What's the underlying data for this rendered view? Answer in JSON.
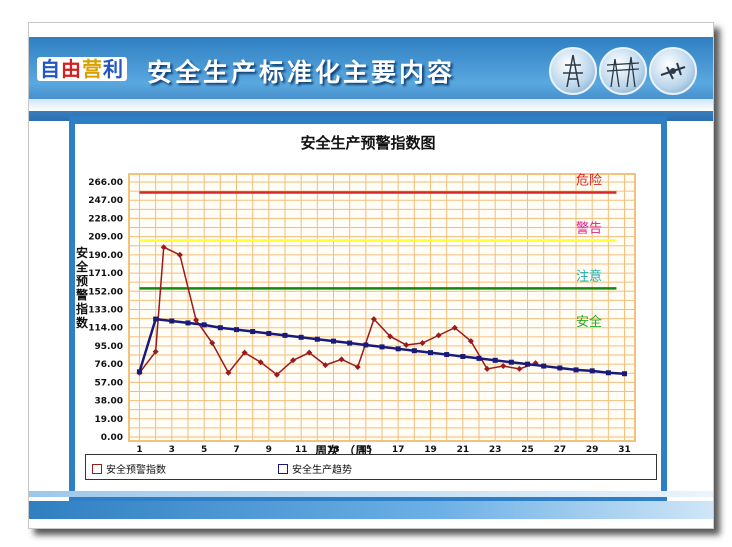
{
  "header": {
    "logo": [
      "自",
      "由",
      "营",
      "利"
    ],
    "title": "安全生产标准化主要内容"
  },
  "chart_data": {
    "type": "line",
    "title": "安全生产预警指数图",
    "xlabel": "周次 （周）",
    "ylabel": "安全预警指数",
    "ylim": [
      0,
      266
    ],
    "yticks": [
      "0.00",
      "19.00",
      "38.00",
      "57.00",
      "76.00",
      "95.00",
      "114.00",
      "133.00",
      "152.00",
      "171.00",
      "190.00",
      "209.00",
      "228.00",
      "247.00",
      "266.00"
    ],
    "xticks": [
      "1",
      "3",
      "5",
      "7",
      "9",
      "11",
      "13",
      "15",
      "17",
      "19",
      "21",
      "23",
      "25",
      "27",
      "29",
      "31"
    ],
    "x": [
      1,
      2,
      3,
      4,
      5,
      6,
      7,
      8,
      9,
      10,
      11,
      12,
      13,
      14,
      15,
      16,
      17,
      18,
      19,
      20,
      21,
      22,
      23,
      24,
      25,
      26,
      27,
      28,
      29,
      30,
      31
    ],
    "thresholds": [
      {
        "label": "危险",
        "value": 255,
        "color": "#d42a2a"
      },
      {
        "label": "警告",
        "value": 205,
        "color": "#ffff33"
      },
      {
        "label": "注意",
        "value": 155,
        "color": "#118811"
      },
      {
        "label": "安全",
        "value": 0,
        "color": "#22aa22"
      }
    ],
    "threshold_label_colors": {
      "危险": "#d42a2a",
      "警告": "#e0208c",
      "注意": "#20b0b0",
      "安全": "#22aa22"
    },
    "series": [
      {
        "name": "安全预警指数",
        "color": "#9b1a1a",
        "x": [
          1,
          2,
          2.5,
          3.5,
          4.5,
          5.5,
          6.5,
          7.5,
          8.5,
          9.5,
          10.5,
          11.5,
          12.5,
          13.5,
          14.5,
          15.5,
          16.5,
          17.5,
          18.5,
          19.5,
          20.5,
          21.5,
          22.5,
          23.5,
          24.5,
          25.5
        ],
        "values": [
          67,
          89,
          198,
          190,
          122,
          98,
          67,
          88,
          78,
          65,
          80,
          88,
          75,
          81,
          73,
          123,
          105,
          96,
          98,
          106,
          114,
          100,
          71,
          74,
          71,
          77
        ]
      },
      {
        "name": "安全生产趋势",
        "color": "#1a1a7a",
        "x": [
          1,
          2,
          3,
          4,
          5,
          6,
          7,
          8,
          9,
          10,
          11,
          12,
          13,
          14,
          15,
          16,
          17,
          18,
          19,
          20,
          21,
          22,
          23,
          24,
          25,
          26,
          27,
          28,
          29,
          30,
          31
        ],
        "values": [
          68,
          123,
          121,
          119,
          117,
          114,
          112,
          110,
          108,
          106,
          104,
          102,
          100,
          98,
          96,
          94,
          92,
          90,
          88,
          86,
          84,
          82,
          80,
          78,
          76,
          74,
          72,
          70,
          69,
          67,
          66
        ]
      }
    ]
  }
}
